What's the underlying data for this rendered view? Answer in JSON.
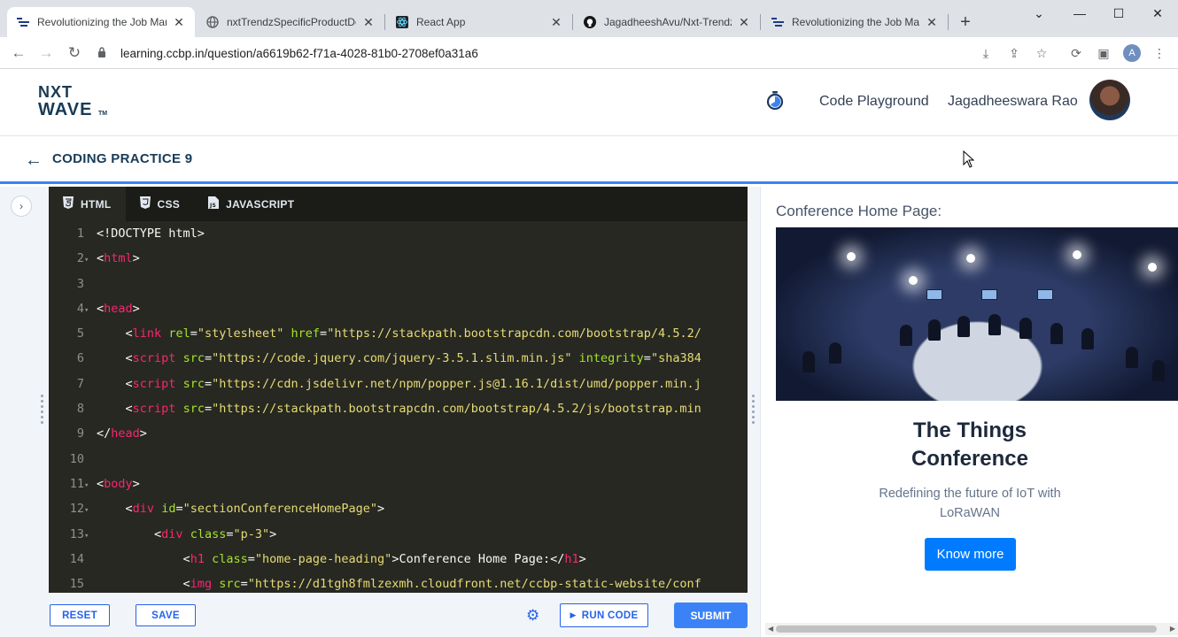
{
  "browser": {
    "tabs": [
      {
        "title": "Revolutionizing the Job Mark",
        "active": true
      },
      {
        "title": "nxtTrendzSpecificProductDet",
        "active": false
      },
      {
        "title": "React App",
        "active": false
      },
      {
        "title": "JagadheeshAvu/Nxt-Trendz-",
        "active": false
      },
      {
        "title": "Revolutionizing the Job Mark",
        "active": false
      }
    ],
    "url": "learning.ccbp.in/question/a6619b62-f71a-4028-81b0-2708ef0a31a6",
    "profile_initial": "A"
  },
  "header": {
    "logo_line1": "NXT",
    "logo_line2": "WAVE",
    "logo_tm": "TM",
    "playground_label": "Code Playground",
    "username": "Jagadheeswara Rao"
  },
  "page": {
    "title": "CODING PRACTICE 9"
  },
  "editor": {
    "tabs": [
      "HTML",
      "CSS",
      "JAVASCRIPT"
    ],
    "lines": [
      {
        "n": "1",
        "fold": false,
        "indent": "",
        "parts": [
          [
            "ct",
            "<!DOCTYPE html>"
          ]
        ]
      },
      {
        "n": "2",
        "fold": true,
        "indent": "",
        "parts": [
          [
            "ct",
            "<"
          ],
          [
            "tg",
            "html"
          ],
          [
            "ct",
            ">"
          ]
        ]
      },
      {
        "n": "3",
        "fold": false,
        "indent": "",
        "parts": []
      },
      {
        "n": "4",
        "fold": true,
        "indent": "",
        "parts": [
          [
            "ct",
            "<"
          ],
          [
            "tg",
            "head"
          ],
          [
            "ct",
            ">"
          ]
        ]
      },
      {
        "n": "5",
        "fold": false,
        "indent": "    ",
        "parts": [
          [
            "ct",
            "<"
          ],
          [
            "tg",
            "link"
          ],
          [
            "ct",
            " "
          ],
          [
            "at",
            "rel"
          ],
          [
            "ct",
            "="
          ],
          [
            "st",
            "\"stylesheet\""
          ],
          [
            "ct",
            " "
          ],
          [
            "at",
            "href"
          ],
          [
            "ct",
            "="
          ],
          [
            "st",
            "\"https://stackpath.bootstrapcdn.com/bootstrap/4.5.2/"
          ]
        ]
      },
      {
        "n": "6",
        "fold": false,
        "indent": "    ",
        "parts": [
          [
            "ct",
            "<"
          ],
          [
            "tg",
            "script"
          ],
          [
            "ct",
            " "
          ],
          [
            "at",
            "src"
          ],
          [
            "ct",
            "="
          ],
          [
            "st",
            "\"https://code.jquery.com/jquery-3.5.1.slim.min.js\""
          ],
          [
            "ct",
            " "
          ],
          [
            "at",
            "integrity"
          ],
          [
            "ct",
            "="
          ],
          [
            "st",
            "\"sha384"
          ]
        ]
      },
      {
        "n": "7",
        "fold": false,
        "indent": "    ",
        "parts": [
          [
            "ct",
            "<"
          ],
          [
            "tg",
            "script"
          ],
          [
            "ct",
            " "
          ],
          [
            "at",
            "src"
          ],
          [
            "ct",
            "="
          ],
          [
            "st",
            "\"https://cdn.jsdelivr.net/npm/popper.js@1.16.1/dist/umd/popper.min.j"
          ]
        ]
      },
      {
        "n": "8",
        "fold": false,
        "indent": "    ",
        "parts": [
          [
            "ct",
            "<"
          ],
          [
            "tg",
            "script"
          ],
          [
            "ct",
            " "
          ],
          [
            "at",
            "src"
          ],
          [
            "ct",
            "="
          ],
          [
            "st",
            "\"https://stackpath.bootstrapcdn.com/bootstrap/4.5.2/js/bootstrap.min"
          ]
        ]
      },
      {
        "n": "9",
        "fold": false,
        "indent": "",
        "parts": [
          [
            "ct",
            "</"
          ],
          [
            "tg",
            "head"
          ],
          [
            "ct",
            ">"
          ]
        ]
      },
      {
        "n": "10",
        "fold": false,
        "indent": "",
        "parts": []
      },
      {
        "n": "11",
        "fold": true,
        "indent": "",
        "parts": [
          [
            "ct",
            "<"
          ],
          [
            "tg",
            "body"
          ],
          [
            "ct",
            ">"
          ]
        ]
      },
      {
        "n": "12",
        "fold": true,
        "indent": "    ",
        "parts": [
          [
            "ct",
            "<"
          ],
          [
            "tg",
            "div"
          ],
          [
            "ct",
            " "
          ],
          [
            "at",
            "id"
          ],
          [
            "ct",
            "="
          ],
          [
            "st",
            "\"sectionConferenceHomePage\""
          ],
          [
            "ct",
            ">"
          ]
        ]
      },
      {
        "n": "13",
        "fold": true,
        "indent": "        ",
        "parts": [
          [
            "ct",
            "<"
          ],
          [
            "tg",
            "div"
          ],
          [
            "ct",
            " "
          ],
          [
            "at",
            "class"
          ],
          [
            "ct",
            "="
          ],
          [
            "st",
            "\"p-3\""
          ],
          [
            "ct",
            ">"
          ]
        ]
      },
      {
        "n": "14",
        "fold": false,
        "indent": "            ",
        "parts": [
          [
            "ct",
            "<"
          ],
          [
            "tg",
            "h1"
          ],
          [
            "ct",
            " "
          ],
          [
            "at",
            "class"
          ],
          [
            "ct",
            "="
          ],
          [
            "st",
            "\"home-page-heading\""
          ],
          [
            "ct",
            ">Conference Home Page:</"
          ],
          [
            "tg",
            "h1"
          ],
          [
            "ct",
            ">"
          ]
        ]
      },
      {
        "n": "15",
        "fold": false,
        "indent": "            ",
        "parts": [
          [
            "ct",
            "<"
          ],
          [
            "tg",
            "img"
          ],
          [
            "ct",
            " "
          ],
          [
            "at",
            "src"
          ],
          [
            "ct",
            "="
          ],
          [
            "st",
            "\"https://d1tgh8fmlzexmh.cloudfront.net/ccbp-static-website/conf"
          ]
        ]
      }
    ],
    "buttons": {
      "reset": "RESET",
      "save": "SAVE",
      "run": "RUN CODE",
      "submit": "SUBMIT"
    }
  },
  "preview": {
    "heading": "Conference Home Page:",
    "title_line1": "The Things",
    "title_line2": "Conference",
    "subtitle": "Redefining the future of IoT with LoRaWAN",
    "button_label": "Know more"
  },
  "colors": {
    "brand": "#183b56",
    "accent": "#3b82f6",
    "bootstrap_primary": "#007bff",
    "editor_bg": "#272822"
  }
}
